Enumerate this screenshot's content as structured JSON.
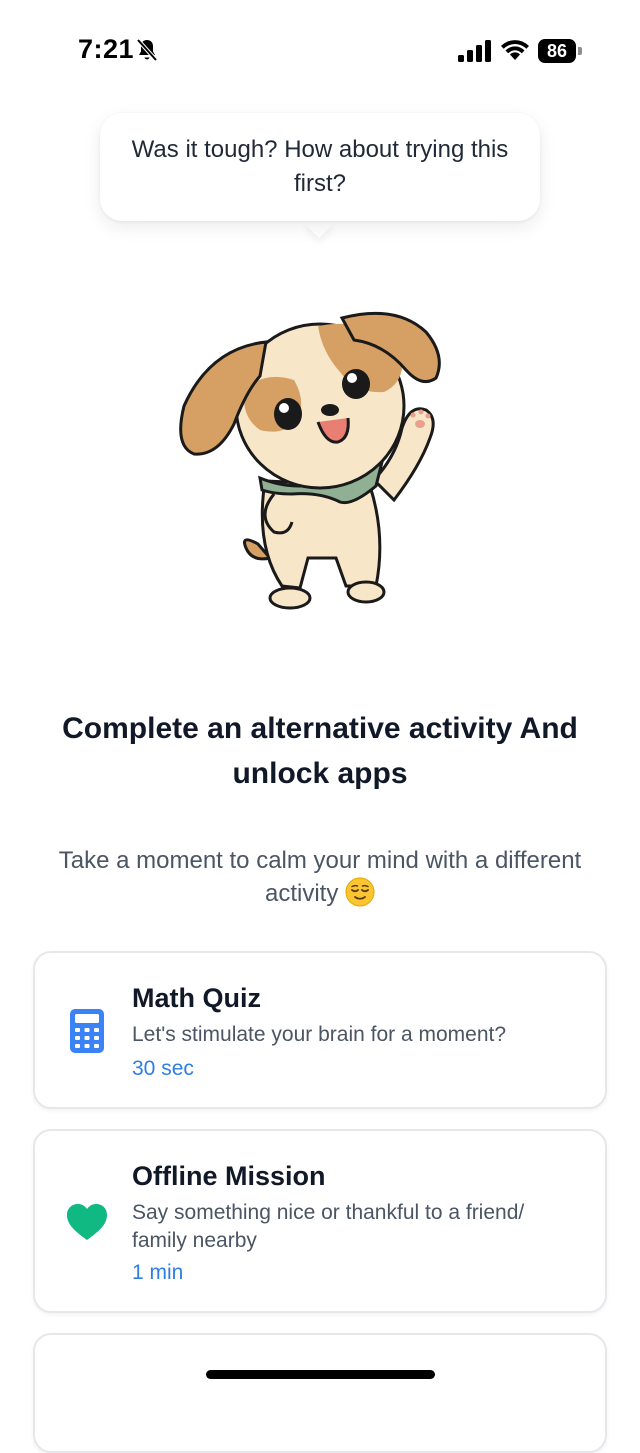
{
  "status_bar": {
    "time": "7:21",
    "battery": "86",
    "icons": [
      "bell-slash-icon",
      "cellular-signal-icon",
      "wifi-icon",
      "battery-icon"
    ]
  },
  "mascot": {
    "speech": "Was it tough? How about trying this first?",
    "icon": "waving-puppy-illustration"
  },
  "headline": "Complete an alternative activity And unlock apps",
  "subtitle": "Take a moment to calm your mind with a different activity",
  "subtitle_emoji": "relieved-face-emoji",
  "activities": [
    {
      "title": "Math Quiz",
      "description": "Let's stimulate your brain for a moment?",
      "duration": "30 sec",
      "icon": "calculator-icon",
      "icon_color": "#3b82f6"
    },
    {
      "title": "Offline Mission",
      "description": "Say something nice or thankful to a friend/ family nearby",
      "duration": "1 min",
      "icon": "heart-icon",
      "icon_color": "#10b981"
    }
  ],
  "colors": {
    "accent": "#2f7ee6",
    "text_primary": "#111827",
    "text_secondary": "#4b5563",
    "card_border": "#e5e7eb"
  }
}
